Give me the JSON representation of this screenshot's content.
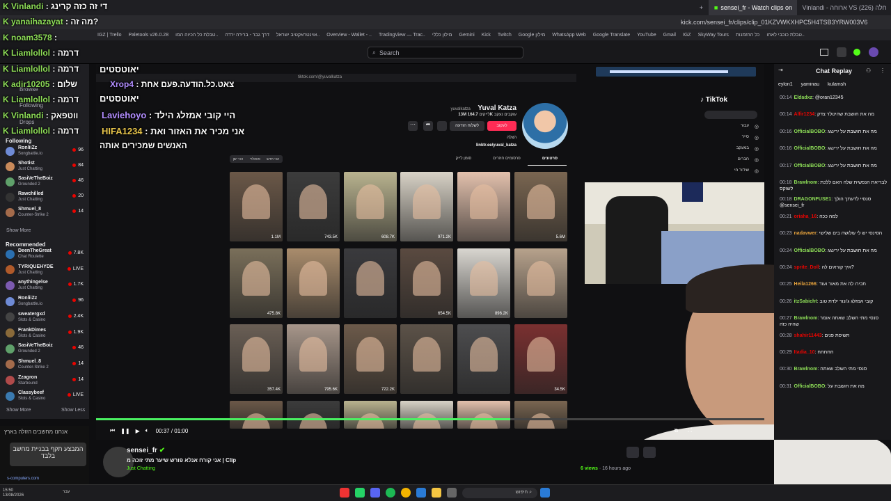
{
  "browser": {
    "tabs": [
      "sensei_fr - Watch clips on",
      "Vinlandi - ארוחה VS חלה (226)"
    ],
    "url": "kick.com/sensei_fr/clips/clip_01KZVWKXHPC5H4TSB3YRW003V6",
    "bookmarks": [
      "IGZ | Trello",
      "Paletools v26.0.28",
      "טבלת כל הכיוה המו..",
      "דרך גבר - ברירה ירדה",
      "אוינטראקטיב ישראל..",
      "Overview - Wallet - ..",
      "TradingView — Trac..",
      "מילון כללי",
      "Gemini",
      "Kick",
      "Twitch",
      "Google מילון",
      "WhatsApp Web",
      "Google Translate",
      "YouTube",
      "Gmail",
      "IGZ",
      "SkyWay Tours",
      "כל ההזמנות",
      "טבלת כוכבי לאחו.."
    ]
  },
  "topbar": {
    "search_placeholder": "Search"
  },
  "sidebar": {
    "browse_label": "Browse",
    "following_nav_label": "Following",
    "drops_label": "Drops",
    "following_header": "Following",
    "following": [
      {
        "name": "RonliiZz",
        "game": "Songbattle.io",
        "viewers": "96",
        "color": "#6f8bd6"
      },
      {
        "name": "Shotist",
        "game": "Just Chatting",
        "viewers": "84",
        "color": "#c98a5a"
      },
      {
        "name": "SasiVeTheBoiz",
        "game": "Grounded 2",
        "viewers": "46",
        "color": "#5fa06a"
      },
      {
        "name": "Rawchilled",
        "game": "Just Chatting",
        "viewers": "20",
        "color": "#333"
      },
      {
        "name": "Shmuel_8",
        "game": "Counter-Strike 2",
        "viewers": "14",
        "color": "#a46b4b"
      }
    ],
    "show_more_1": "Show More",
    "recommended_header": "Recommended",
    "recommended": [
      {
        "name": "DeenTheGreat",
        "game": "Chat Roulette",
        "viewers": "7.8K",
        "color": "#2a6fb0"
      },
      {
        "name": "TYRIQUEHYDE",
        "game": "Just Chatting",
        "viewers": "LIVE",
        "color": "#b05a2a"
      },
      {
        "name": "anythingelse",
        "game": "Just Chatting",
        "viewers": "1.7K",
        "color": "#7c5ab0"
      },
      {
        "name": "RonliiZz",
        "game": "Songbattle.io",
        "viewers": "96",
        "color": "#6f8bd6"
      },
      {
        "name": "sweatergxd",
        "game": "Slots & Casino",
        "viewers": "2.4K",
        "color": "#444"
      },
      {
        "name": "FrankDimes",
        "game": "Slots & Casino",
        "viewers": "1.9K",
        "color": "#8a6a3a"
      },
      {
        "name": "SasiVeTheBoiz",
        "game": "Grounded 2",
        "viewers": "46",
        "color": "#5fa06a"
      },
      {
        "name": "Shmuel_8",
        "game": "Counter-Strike 2",
        "viewers": "14",
        "color": "#a46b4b"
      },
      {
        "name": "Zzagron",
        "game": "Starbound",
        "viewers": "14",
        "color": "#b04a4a"
      },
      {
        "name": "Classybeef",
        "game": "Slots & Casino",
        "viewers": "LIVE",
        "color": "#3a7ab0"
      }
    ],
    "show_more_2": "Show More",
    "show_less": "Show Less"
  },
  "overlay_chat": [
    {
      "user": "Vinlandi",
      "msg": "די זה כזה קרינג"
    },
    {
      "user": "yanaihazayat",
      "msg": "מה זה?"
    },
    {
      "user": "noam3578",
      "msg": ""
    },
    {
      "user": "Liamlollol",
      "msg": "דרמה"
    },
    {
      "user": "Liamlollol",
      "msg": "דרמה"
    },
    {
      "user": "adir10205",
      "msg": "שלום"
    },
    {
      "user": "Liamlollol",
      "msg": "דרמה"
    },
    {
      "user": "Vinlandi",
      "msg": "ווטפאק"
    },
    {
      "user": "Liamlollol",
      "msg": "דרמה"
    }
  ],
  "video_overlay": {
    "top_title": "יאוטסטים",
    "xrop_user": "Xrop4",
    "xrop_msg": "צאט.כל.הודעה.פעם אחת",
    "lavie_user": "Laviehoyo",
    "lavie_msg": "היי קובי אמזלג הילד",
    "hifa_user": "HIFA1234",
    "hifa_msg": "אני מכיר את האזור ואת",
    "line3": "האנשים שמכירים אותה",
    "inner_url": "tiktok.com/@yuvalkatza"
  },
  "tiktok": {
    "brand": "TikTok",
    "display_name": "Yuval Katza",
    "handle": "yuvalkatza",
    "following_count": "13M",
    "followers_count": "164.7K",
    "likes_label": "לייקים",
    "followers_label": "עוקבים",
    "following_label": "נעקב",
    "follow_btn": "לעקוב",
    "message_btn": "לשלוח הודעה",
    "bio": "הצלה",
    "link": "linktr.ee/yuval_katza",
    "tabs": [
      "סרטונים",
      "פרסומים חוזרים",
      "סומן לייק"
    ],
    "sort_tabs": [
      "הכי חדש",
      "פופולרי",
      "הכי ישן"
    ],
    "nav": [
      "עבור",
      "סייר",
      "במעקב",
      "חברים",
      "שידור חי"
    ],
    "grid_counts": [
      "5.6M",
      "",
      "971.2K",
      "608.7K",
      "743.5K",
      "1.1M",
      "",
      "896.2K",
      "654.5K",
      "",
      "",
      "475.8K",
      "34.5K",
      "",
      "",
      "722.2K",
      "795.6K",
      "357.4K"
    ]
  },
  "chat": {
    "title": "Chat Replay",
    "top_users": [
      "eylon1",
      "yaminau",
      "kulamsh"
    ],
    "messages": [
      {
        "t": "00:14",
        "u": "Eldadxz",
        "c": "#8ddc57",
        "m": "@oran12345"
      },
      {
        "t": "00:14",
        "u": "Alfir1234",
        "c": "#eb0400",
        "m": "מה את חושבת שהיטלר צדק"
      },
      {
        "t": "00:16",
        "u": "OfficialBOBO",
        "c": "#8ddc57",
        "m": "מה את חושבת על ירינגג"
      },
      {
        "t": "00:16",
        "u": "OfficialBOBO",
        "c": "#8ddc57",
        "m": "מה את חושבת על ירינגג"
      },
      {
        "t": "00:17",
        "u": "OfficialBOBO",
        "c": "#8ddc57",
        "m": "מה את חושבת על ירינגג"
      },
      {
        "t": "00:18",
        "u": "Brawlnom",
        "c": "#8ddc57",
        "m": "לבריאת הנפשית שלה האם ללכת לשוקס"
      },
      {
        "t": "00:18",
        "u": "DRAGONFUSE1",
        "c": "#8ddc57",
        "m": "סנסיי לדעתך הולך @sensei_fr"
      },
      {
        "t": "00:21",
        "u": "oriaha_16",
        "c": "#eb0400",
        "m": "למה ככה"
      },
      {
        "t": "00:23",
        "u": "nadavwer",
        "c": "#e6a23c",
        "m": "הסינסי יש לי שלושה בים שלישי"
      },
      {
        "t": "00:24",
        "u": "OfficialBOBO",
        "c": "#8ddc57",
        "m": "מה את חושבת על ירינגג"
      },
      {
        "t": "00:24",
        "u": "sprite_Doll",
        "c": "#eb0400",
        "m": "איך קוראים לה?"
      },
      {
        "t": "00:25",
        "u": "Heila1266",
        "c": "#e6a23c",
        "m": "תכירו לה את מאור ועוד"
      },
      {
        "t": "00:26",
        "u": "itzSabicht",
        "c": "#8ddc57",
        "m": "קובי אמזלג ג'ונור ילדת טוב"
      },
      {
        "t": "00:27",
        "u": "Brawlnom",
        "c": "#8ddc57",
        "m": "סנסי מתי השלב שאתה אומר שהיה כזה"
      },
      {
        "t": "00:28",
        "u": "shahir11443",
        "c": "#eb0400",
        "m": "תשיפת פנים"
      },
      {
        "t": "00:29",
        "u": "Itadia_10",
        "c": "#eb0400",
        "m": "חחחחח"
      },
      {
        "t": "00:30",
        "u": "Brawlnom",
        "c": "#8ddc57",
        "m": "סנסי מתי השלב שאתה"
      },
      {
        "t": "00:31",
        "u": "OfficialBOBO",
        "c": "#8ddc57",
        "m": "מה את חושבת על"
      }
    ]
  },
  "player": {
    "time": "00:37 / 01:00",
    "progress": 0.62
  },
  "info": {
    "channel": "sensei_fr",
    "clip_title": "אני קורח אנלא פורש שיער מתי זוכה מ | Clip",
    "category": "Just Chatting",
    "views": "6 views",
    "age": "16 hours ago",
    "overlay_text_1": "המבצע תקף בבניית מחשב בלבד",
    "overlay_text_2": "אנחנו מחשבים הזולה בארץ",
    "overlay_domain": "s-computers.com"
  },
  "taskbar": {
    "search": "חיפוש",
    "time": "15:50",
    "date": "13/08/2026",
    "lang": "עבר"
  }
}
